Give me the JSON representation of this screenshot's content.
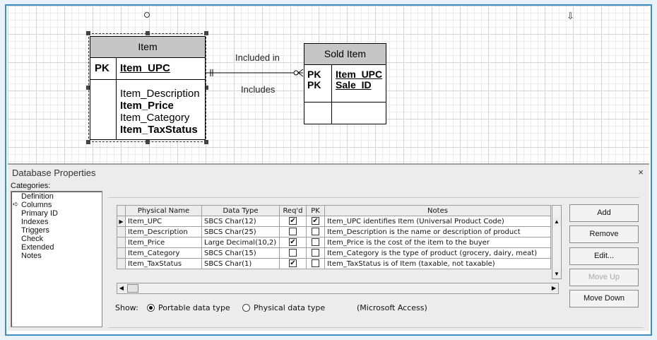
{
  "diagram": {
    "entity_item": {
      "title": "Item",
      "pk_label": "PK",
      "pk_field": "Item_UPC",
      "fields": [
        {
          "name": "Item_Description",
          "bold": false
        },
        {
          "name": "Item_Price",
          "bold": true
        },
        {
          "name": "Item_Category",
          "bold": false
        },
        {
          "name": "Item_TaxStatus",
          "bold": true
        }
      ]
    },
    "entity_sold_item": {
      "title": "Sold Item",
      "pk_label": "PK",
      "pk_fields": [
        "Item_UPC",
        "Sale_ID"
      ]
    },
    "relationship": {
      "forward_label": "Included in",
      "reverse_label": "Includes"
    }
  },
  "properties": {
    "title": "Database Properties",
    "close_glyph": "×",
    "categories_label": "Categories:",
    "categories": [
      {
        "label": "Definition",
        "selected": false
      },
      {
        "label": "Columns",
        "selected": true
      },
      {
        "label": "Primary ID",
        "selected": false
      },
      {
        "label": "Indexes",
        "selected": false
      },
      {
        "label": "Triggers",
        "selected": false
      },
      {
        "label": "Check",
        "selected": false
      },
      {
        "label": "Extended",
        "selected": false
      },
      {
        "label": "Notes",
        "selected": false
      }
    ],
    "columns_table": {
      "headers": [
        "Physical Name",
        "Data Type",
        "Req'd",
        "PK",
        "Notes"
      ],
      "rows": [
        {
          "name": "Item_UPC",
          "type": "SBCS Char(12)",
          "reqd": true,
          "pk": true,
          "notes": "Item_UPC identifies Item (Universal Product Code)"
        },
        {
          "name": "Item_Description",
          "type": "SBCS Char(25)",
          "reqd": false,
          "pk": false,
          "notes": "Item_Description is the name or description of product"
        },
        {
          "name": "Item_Price",
          "type": "Large Decimal(10,2)",
          "reqd": true,
          "pk": false,
          "notes": "Item_Price is the cost of the item to the buyer"
        },
        {
          "name": "Item_Category",
          "type": "SBCS Char(15)",
          "reqd": false,
          "pk": false,
          "notes": "Item_Category is the type of product (grocery, dairy, meat)"
        },
        {
          "name": "Item_TaxStatus",
          "type": "SBCS Char(1)",
          "reqd": true,
          "pk": false,
          "notes": "Item_TaxStatus is of Item (taxable, not taxable)"
        }
      ]
    },
    "buttons": {
      "add": "Add",
      "remove": "Remove",
      "edit": "Edit...",
      "move_up": "Move Up",
      "move_down": "Move Down"
    },
    "show": {
      "label": "Show:",
      "portable": "Portable data type",
      "physical": "Physical data type",
      "target": "(Microsoft Access)",
      "selected": "portable"
    }
  }
}
